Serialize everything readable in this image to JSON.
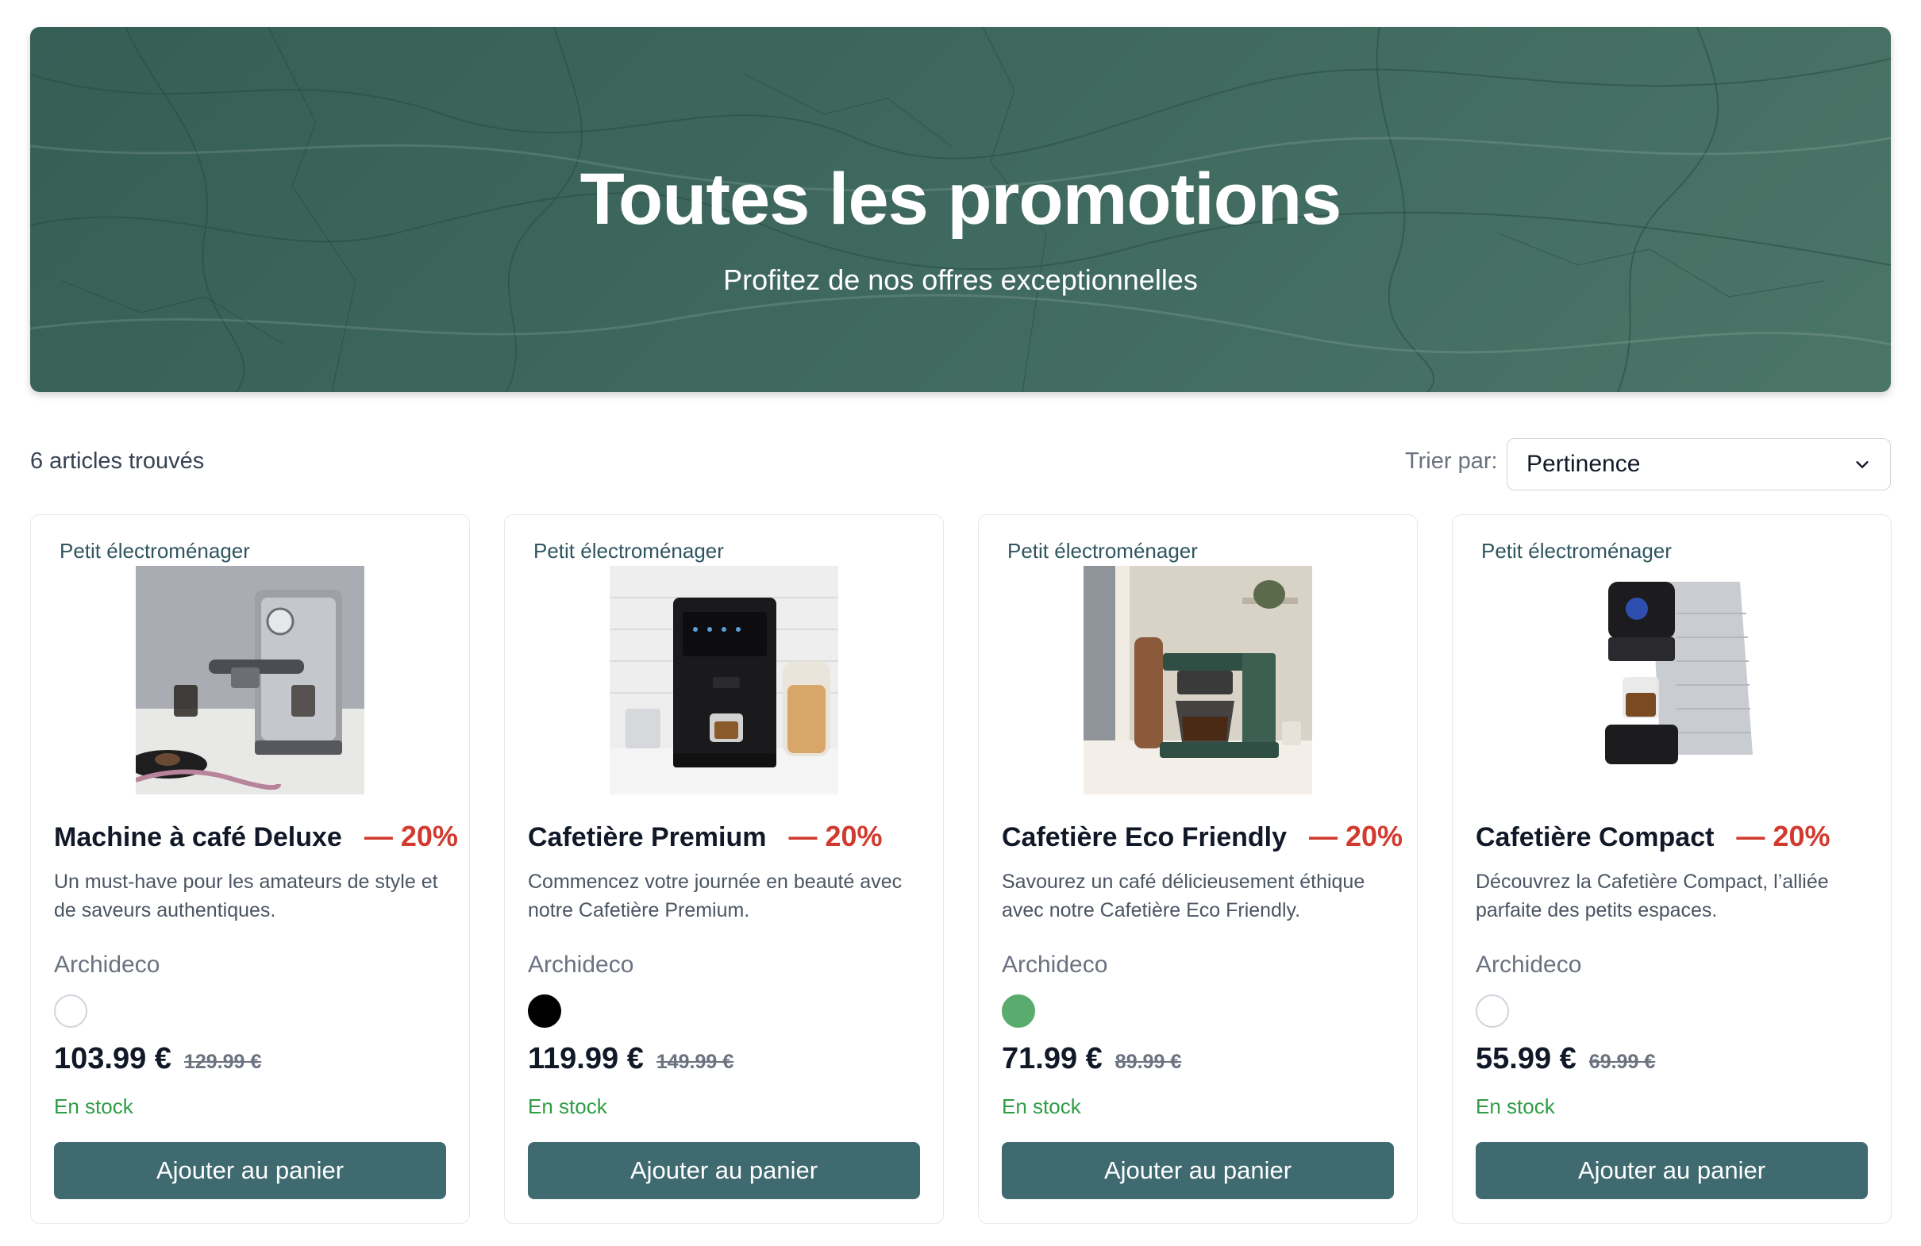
{
  "hero": {
    "title": "Toutes les promotions",
    "subtitle": "Profitez de nos offres exceptionnelles"
  },
  "toolbar": {
    "count": "6 articles trouvés",
    "sort_label": "Trier par:",
    "sort_value": "Pertinence"
  },
  "colors": {
    "hero": "#3e685e",
    "button": "#3f6a70",
    "discount": "#d13a2e",
    "stock": "#2e9d44"
  },
  "products": [
    {
      "category": "Petit électroménager",
      "name": "Machine à café Deluxe",
      "discount": "— 20%",
      "description": "Un must-have pour les amateurs de style et de saveurs authentiques.",
      "brand": "Archideco",
      "swatch_color": "#ffffff",
      "price": "103.99 €",
      "old_price": "129.99 €",
      "stock": "En stock",
      "button": "Ajouter au panier",
      "image_icon": "espresso-machine-image"
    },
    {
      "category": "Petit électroménager",
      "name": "Cafetière Premium",
      "discount": "— 20%",
      "description": "Commencez votre journée en beauté avec notre Cafetière Premium.",
      "brand": "Archideco",
      "swatch_color": "#000000",
      "price": "119.99 €",
      "old_price": "149.99 €",
      "stock": "En stock",
      "button": "Ajouter au panier",
      "image_icon": "bean-to-cup-machine-image"
    },
    {
      "category": "Petit électroménager",
      "name": "Cafetière Eco Friendly",
      "discount": "— 20%",
      "description": "Savourez un café délicieusement éthique avec notre Cafetière Eco Friendly.",
      "brand": "Archideco",
      "swatch_color": "#5aab6e",
      "price": "71.99 €",
      "old_price": "89.99 €",
      "stock": "En stock",
      "button": "Ajouter au panier",
      "image_icon": "drip-coffee-maker-image"
    },
    {
      "category": "Petit électroménager",
      "name": "Cafetière Compact",
      "discount": "— 20%",
      "description": "Découvrez la Cafetière Compact, l’alliée parfaite des petits espaces.",
      "brand": "Archideco",
      "swatch_color": "#ffffff",
      "price": "55.99 €",
      "old_price": "69.99 €",
      "stock": "En stock",
      "button": "Ajouter au panier",
      "image_icon": "capsule-machine-image"
    }
  ]
}
